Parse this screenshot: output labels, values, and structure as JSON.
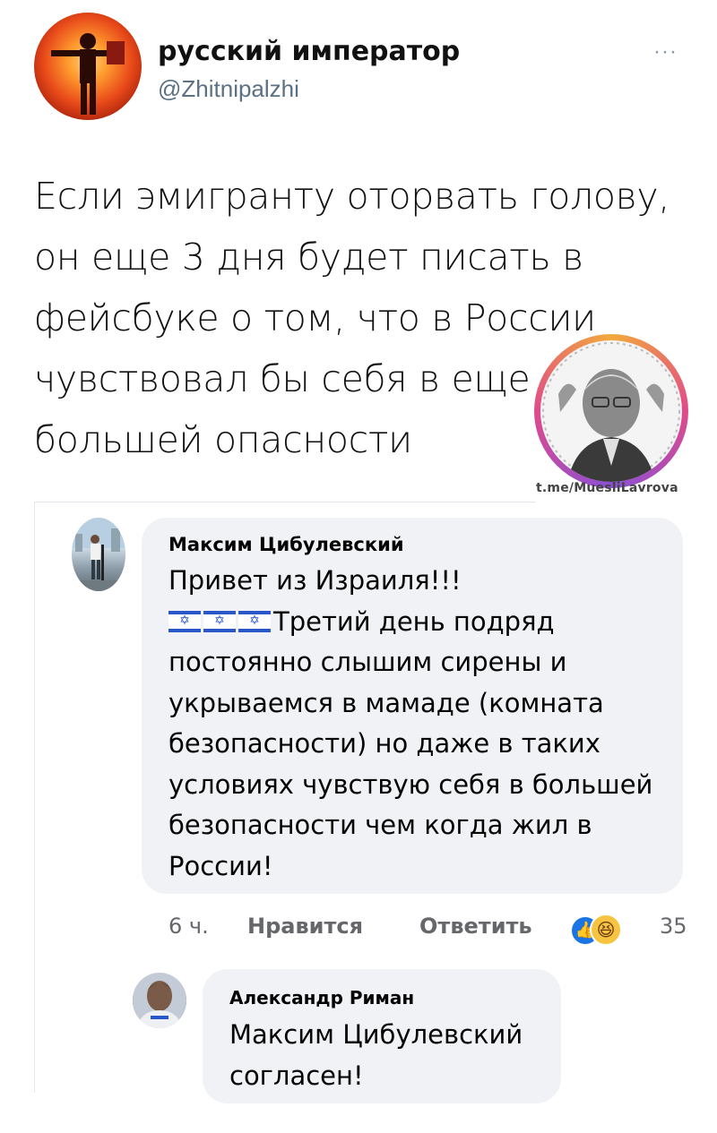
{
  "tweet": {
    "author_name": "русский император",
    "author_handle": "@Zhitnipalzhi",
    "more_label": "···",
    "text_lines": [
      "Если эмигранту оторвать голову,",
      "он еще 3 дня будет писать в",
      "фейсбуке о том, что в России",
      "чувствовал бы себя в еще",
      "большей опасности"
    ]
  },
  "watermark": {
    "url": "t.me/MuesliLavrova"
  },
  "comment": {
    "author": "Максим Цибулевский",
    "lines": [
      "Привет из Израиля!!!",
      "Третий день подряд",
      "постоянно слышим сирены и",
      "укрываемся в мамаде (комната",
      "безопасности) но даже в таких",
      "условиях чувствую себя в большей",
      "безопасности чем когда жил в",
      "России!"
    ],
    "time": "6 ч.",
    "like_label": "Нравится",
    "reply_label": "Ответить",
    "reaction_count": "35",
    "reaction_icons": [
      "like-icon",
      "haha-icon"
    ]
  },
  "reply": {
    "author": "Александр Риман",
    "lines": [
      "Максим Цибулевский",
      "согласен!"
    ]
  },
  "colors": {
    "handle": "#5b7083",
    "bubble": "#f0f2f5",
    "like_blue": "#1b74e4",
    "israel_blue": "#2a58c8"
  }
}
